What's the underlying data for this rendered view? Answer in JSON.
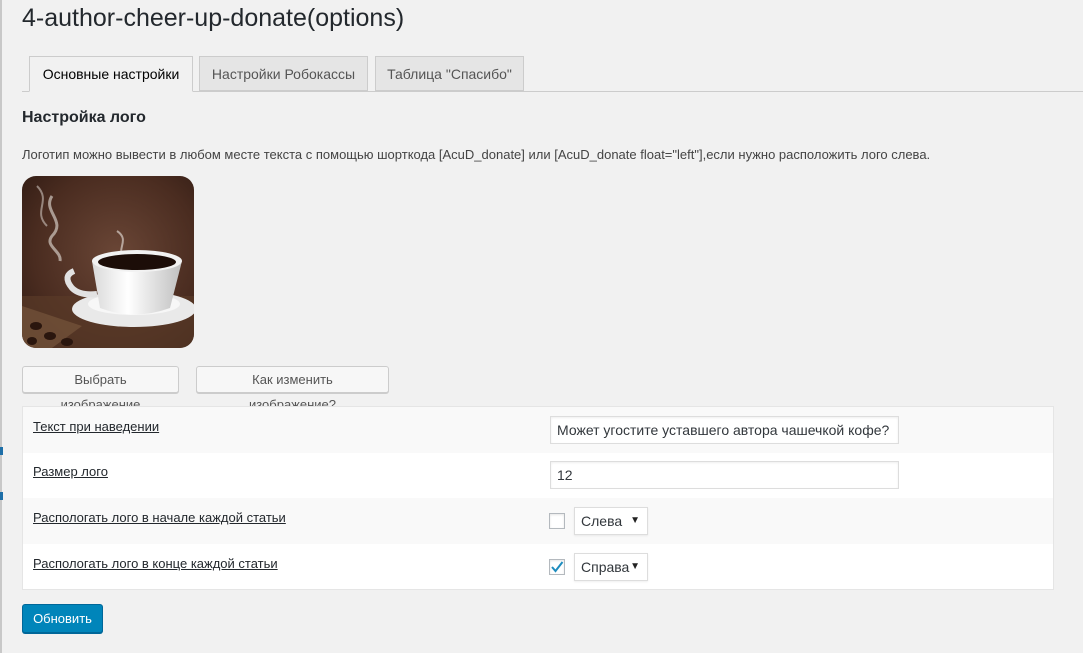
{
  "page": {
    "title": "4-author-cheer-up-donate(options)"
  },
  "tabs": [
    {
      "label": "Основные настройки",
      "active": true
    },
    {
      "label": "Настройки Робокассы",
      "active": false
    },
    {
      "label": "Таблица \"Спасибо\"",
      "active": false
    }
  ],
  "section": {
    "heading": "Настройка лого",
    "description": "Логотип можно вывести в любом месте текста с помощью шорткода [AcuD_donate] или [AcuD_donate float=\"left\"],если нужно расположить лого слева."
  },
  "buttons": {
    "choose_image": "Выбрать изображение",
    "how_to_change": "Как изменить изображение?",
    "update": "Обновить"
  },
  "settings": {
    "hover_text": {
      "label": "Текст при наведении",
      "value": "Может угостите уставшего автора чашечкой кофе?"
    },
    "logo_size": {
      "label": "Размер лого",
      "value": "12"
    },
    "logo_start": {
      "label": "Распологать лого в начале каждой статьи",
      "checked": false,
      "position": "Слева"
    },
    "logo_end": {
      "label": "Распологать лого в конце каждой статьи",
      "checked": true,
      "position": "Справа"
    }
  },
  "colors": {
    "primary_button": "#0085ba",
    "checkmark": "#1e8cbe"
  },
  "icons": {
    "dropdown": "caret-down-icon",
    "check": "check-icon"
  }
}
